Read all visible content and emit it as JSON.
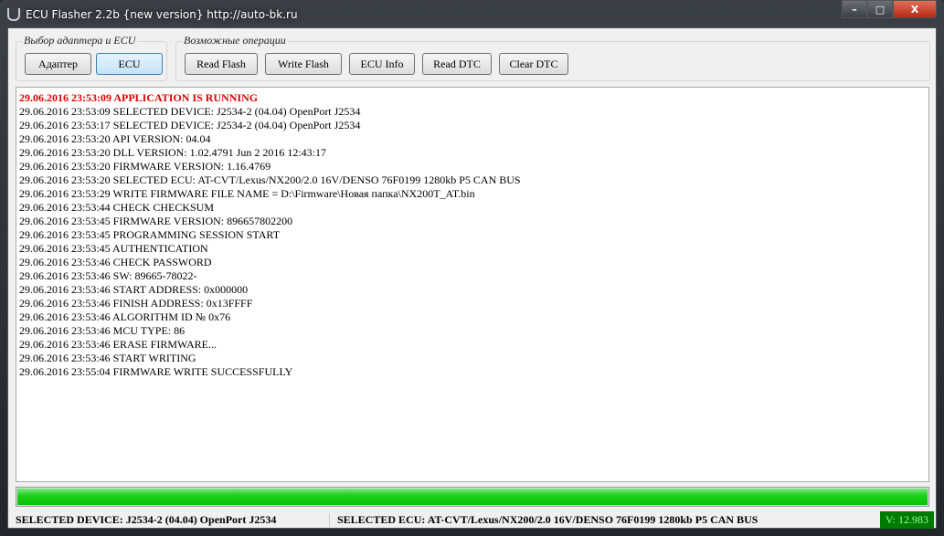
{
  "window": {
    "title": "ECU Flasher 2.2b {new version} http://auto-bk.ru",
    "minimize": "–",
    "maximize": "□",
    "close": "X"
  },
  "groups": {
    "adapter": {
      "label": "Выбор адаптера и ECU",
      "buttons": [
        "Адаптер",
        "ECU"
      ]
    },
    "operations": {
      "label": "Возможные операции",
      "buttons": [
        "Read Flash",
        "Write Flash",
        "ECU Info",
        "Read DTC",
        "Clear DTC"
      ]
    }
  },
  "log": [
    "29.06.2016 23:53:09 APPLICATION IS RUNNING",
    "29.06.2016 23:53:09 SELECTED DEVICE: J2534-2 (04.04) OpenPort J2534",
    "29.06.2016 23:53:17 SELECTED DEVICE: J2534-2 (04.04) OpenPort J2534",
    "29.06.2016 23:53:20 API VERSION: 04.04",
    "29.06.2016 23:53:20 DLL VERSION: 1.02.4791 Jun  2 2016 12:43:17",
    "29.06.2016 23:53:20 FIRMWARE VERSION: 1.16.4769",
    "29.06.2016 23:53:20 SELECTED ECU: AT-CVT/Lexus/NX200/2.0 16V/DENSO 76F0199 1280kb P5 CAN BUS",
    "29.06.2016 23:53:29 WRITE FIRMWARE FILE NAME = D:\\Firmware\\Новая папка\\NX200T_AT.bin",
    "29.06.2016 23:53:44 CHECK CHECKSUM",
    "29.06.2016 23:53:45 FIRMWARE VERSION:     896657802200",
    "29.06.2016 23:53:45 PROGRAMMING SESSION START",
    "29.06.2016 23:53:45 AUTHENTICATION",
    "29.06.2016 23:53:46 CHECK PASSWORD",
    "29.06.2016 23:53:46 SW: 89665-78022-",
    "29.06.2016 23:53:46 START ADDRESS: 0x000000",
    "29.06.2016 23:53:46 FINISH ADDRESS: 0x13FFFF",
    "29.06.2016 23:53:46 ALGORITHM ID № 0x76",
    "29.06.2016 23:53:46 MCU TYPE: 86",
    "29.06.2016 23:53:46 ERASE FIRMWARE...",
    "29.06.2016 23:53:46 START WRITING",
    "29.06.2016 23:55:04 FIRMWARE WRITE SUCCESSFULLY"
  ],
  "progress": {
    "percent": 100,
    "color": "#06c406"
  },
  "status": {
    "device": "SELECTED DEVICE: J2534-2 (04.04) OpenPort J2534",
    "ecu": "SELECTED ECU: AT-CVT/Lexus/NX200/2.0 16V/DENSO 76F0199 1280kb P5 CAN BUS",
    "voltage": "V: 12.983"
  }
}
